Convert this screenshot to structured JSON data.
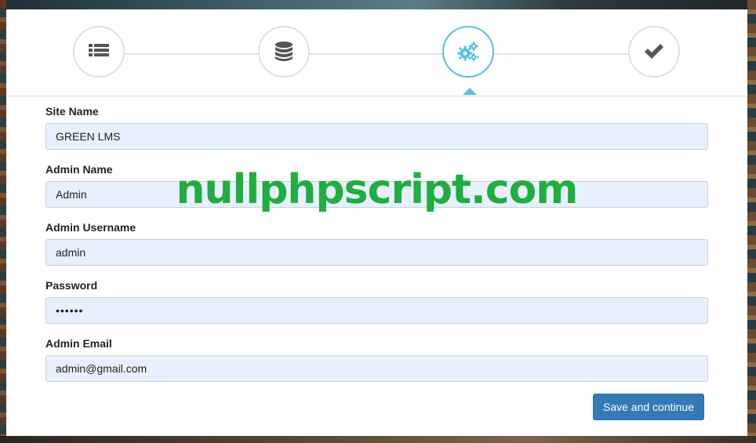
{
  "wizard": {
    "steps": [
      {
        "icon": "list-icon",
        "active": false
      },
      {
        "icon": "database-icon",
        "active": false
      },
      {
        "icon": "gears-icon",
        "active": true
      },
      {
        "icon": "check-icon",
        "active": false
      }
    ],
    "accent_color": "#5bc0de"
  },
  "form": {
    "site_name": {
      "label": "Site Name",
      "value": "GREEN LMS"
    },
    "admin_name": {
      "label": "Admin Name",
      "value": "Admin"
    },
    "admin_username": {
      "label": "Admin Username",
      "value": "admin"
    },
    "password": {
      "label": "Password",
      "value": "••••••"
    },
    "admin_email": {
      "label": "Admin Email",
      "value": "admin@gmail.com"
    },
    "submit_label": "Save and continue",
    "submit_color": "#337ab7"
  },
  "watermark": {
    "text": "nullphpscript.com",
    "color": "#1fae3f"
  }
}
